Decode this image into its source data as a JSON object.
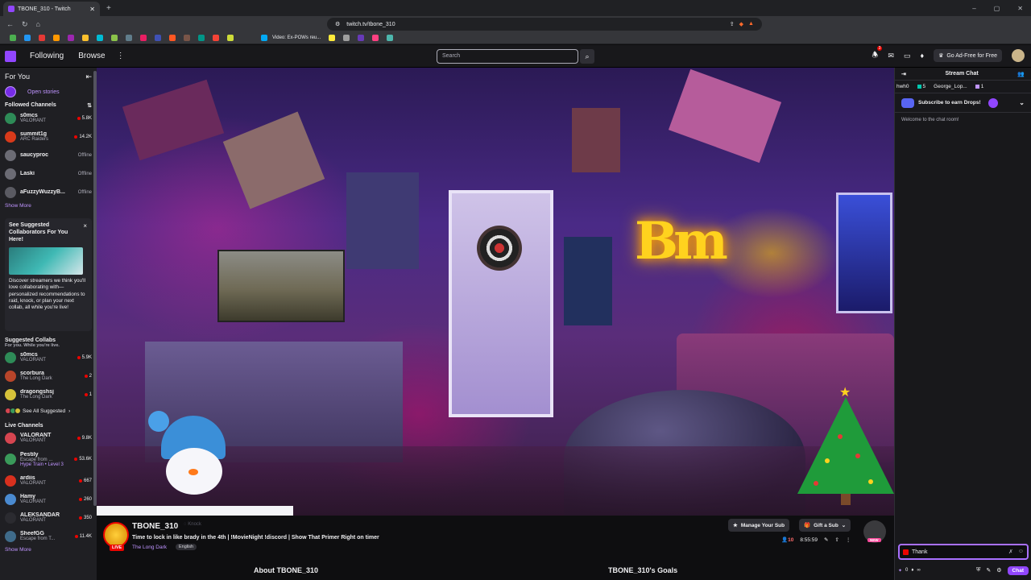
{
  "browser": {
    "tab_title": "TBONE_310 - Twitch",
    "new_tab": "+",
    "url": "twitch.tv/tbone_310",
    "window_controls": [
      "–",
      "▢",
      "✕"
    ],
    "bookmark_text": "Video: Ex-POWs reu..."
  },
  "topnav": {
    "following": "Following",
    "browse": "Browse",
    "more": "⋮",
    "search_placeholder": "Search",
    "notif_count": "3",
    "ad_free": "Go Ad-Free for Free"
  },
  "sidebar": {
    "for_you": "For You",
    "open_stories": "Open stories",
    "followed_title": "Followed Channels",
    "followed": [
      {
        "name": "s0mcs",
        "game": "VALORANT",
        "viewers": "5.8K",
        "color": "#2e8b57"
      },
      {
        "name": "summit1g",
        "game": "ARC Raiders",
        "viewers": "14.2K",
        "color": "#d83a1a"
      },
      {
        "name": "saucyproc",
        "game": "",
        "viewers": "Offline",
        "color": "#6b6b74"
      },
      {
        "name": "Laski",
        "game": "",
        "viewers": "Offline",
        "color": "#6b6b74"
      },
      {
        "name": "aFuzzyWuzzyB...",
        "game": "",
        "viewers": "Offline",
        "color": "#5a5a62"
      }
    ],
    "show_more": "Show More",
    "collab_card": {
      "title": "See Suggested Collaborators For You Here!",
      "close": "×",
      "description": "Discover streamers we think you'll love collaborating with—personalized recommendations to raid, knock, or plan your next collab, all while you're live!"
    },
    "suggested_title": "Suggested Collabs",
    "suggested_sub": "For you. While you're live.",
    "suggested": [
      {
        "name": "s0mcs",
        "game": "VALORANT",
        "viewers": "5.9K",
        "color": "#2e8b57"
      },
      {
        "name": "scorbura",
        "game": "The Long Dark",
        "viewers": "2",
        "color": "#b8452a"
      },
      {
        "name": "dragongshsj",
        "game": "The Long Dark",
        "viewers": "1",
        "color": "#d6c23a"
      }
    ],
    "see_all": "See All Suggested",
    "live_title": "Live Channels",
    "live": [
      {
        "name": "VALORANT",
        "game": "VALORANT",
        "viewers": "9.8K",
        "color": "#d64550"
      },
      {
        "name": "Pestily",
        "game": "Escape from ...",
        "extra": "Hype Train • Level 3",
        "viewers": "53.6K",
        "color": "#3a9a5a"
      },
      {
        "name": "ardiis",
        "game": "VALORANT",
        "viewers": "667",
        "color": "#d8301e"
      },
      {
        "name": "Hamy",
        "game": "VALORANT",
        "viewers": "260",
        "color": "#4a8ad0"
      },
      {
        "name": "ALEKSANDAR",
        "game": "VALORANT",
        "viewers": "350",
        "color": "#2b2b30"
      },
      {
        "name": "SheefGG",
        "game": "Escape from T...",
        "viewers": "11.4K",
        "color": "#3f6b8a"
      }
    ],
    "show_more_2": "Show More"
  },
  "video": {
    "neon_text": "Bm"
  },
  "channel": {
    "name": "TBONE_310",
    "follow_state": "Knock",
    "live_tag": "LIVE",
    "stream_title": "Time to lock in like brady in the 4th | !MovieNight !discord | Show That Primer Right on timer",
    "game": "The Long Dark",
    "language": "English",
    "manage_sub": "Manage Your Sub",
    "gift_sub": "Gift a Sub",
    "viewers": "10",
    "uptime": "8:55:59",
    "new_tag": "NEW",
    "about_tab": "About TBONE_310",
    "goals_tab": "TBONE_310's Goals"
  },
  "chat": {
    "title": "Stream Chat",
    "gifters": [
      {
        "name": "hwh0",
        "count": ""
      },
      {
        "name": "George_Lop...",
        "count": "5"
      },
      {
        "name": "",
        "count": "1"
      }
    ],
    "drops_text": "Subscribe to earn Drops!",
    "welcome": "Welcome to the chat room!",
    "input_value": "Thank",
    "points": "0",
    "inf": "∞",
    "chat_button": "Chat"
  }
}
